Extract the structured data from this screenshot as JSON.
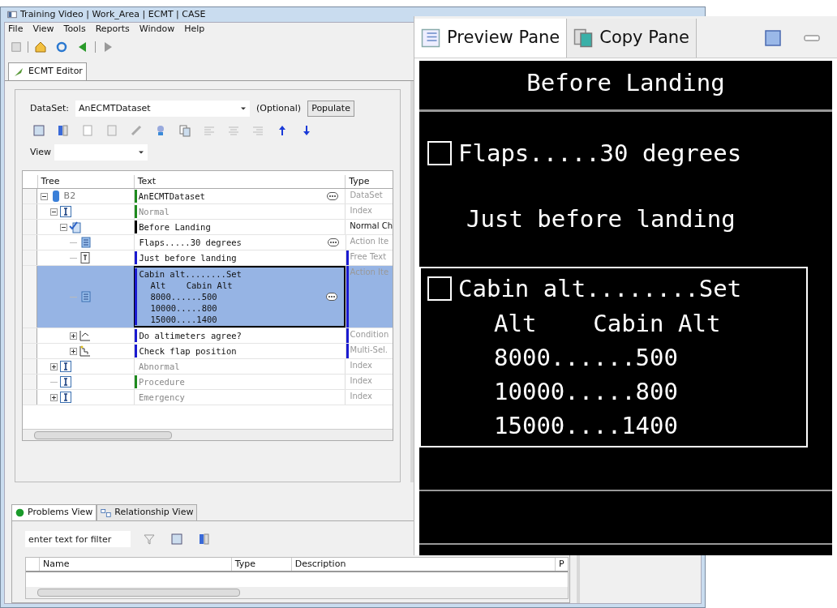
{
  "window": {
    "title": "Training Video | Work_Area | ECMT | CASE"
  },
  "menu": [
    "File",
    "View",
    "Tools",
    "Reports",
    "Window",
    "Help"
  ],
  "editor_tab": {
    "label": "ECMT Editor",
    "selected": true
  },
  "dataset": {
    "label": "DataSet:",
    "value": "AnECMTDataset",
    "optional": "(Optional)",
    "button": "Populate"
  },
  "view": {
    "label": "View"
  },
  "tree_table": {
    "columns": [
      "Tree",
      "Text",
      "Type"
    ],
    "rows": [
      {
        "kind": "dataset",
        "tree_label": "B2",
        "text": "AnECMTDataset",
        "type": "DataSet",
        "type_marked": false,
        "color": "#1e8a1e",
        "expanded": true,
        "selected": false,
        "dimmed": false,
        "more_button": true,
        "children": [
          {
            "kind": "index",
            "text": "Normal",
            "type": "Index",
            "type_marked": false,
            "color": "#1e8a1e",
            "expanded": true,
            "selected": false,
            "dimmed": true,
            "more_button": false,
            "children": [
              {
                "kind": "checklist",
                "text": "Before Landing",
                "type": "Normal Ch",
                "type_marked": false,
                "color": "#000000",
                "expanded": true,
                "selected": false,
                "dimmed": false,
                "more_button": false,
                "children": [
                  {
                    "kind": "action",
                    "text": "Flaps.....30 degrees",
                    "type": "Action Ite",
                    "type_marked": false,
                    "selected": false,
                    "dimmed": false,
                    "more_button": true
                  },
                  {
                    "kind": "freetext",
                    "text": "Just before landing",
                    "type": "Free Text",
                    "color": "#1a1ad0",
                    "type_marked": true,
                    "selected": false,
                    "dimmed": false,
                    "more_button": false
                  },
                  {
                    "kind": "action",
                    "text": "Cabin alt........Set",
                    "lines": [
                      "Alt    Cabin Alt",
                      "8000......500",
                      "10000.....800",
                      "15000....1400"
                    ],
                    "type": "Action Ite",
                    "color": "#1a1ad0",
                    "type_marked": true,
                    "selected": true,
                    "dimmed": false,
                    "more_button": true
                  },
                  {
                    "kind": "condition",
                    "text": "Do altimeters agree?",
                    "type": "Condition",
                    "color": "#1a1ad0",
                    "type_marked": true,
                    "expanded": false,
                    "selected": false,
                    "dimmed": false,
                    "more_button": false
                  },
                  {
                    "kind": "multiselect",
                    "text": "Check flap position",
                    "type": "Multi-Sel.",
                    "color": "#1a1ad0",
                    "type_marked": true,
                    "expanded": false,
                    "selected": false,
                    "dimmed": false,
                    "more_button": false
                  }
                ]
              }
            ]
          },
          {
            "kind": "index",
            "text": "Abnormal",
            "type": "Index",
            "type_marked": false,
            "expanded": false,
            "selected": false,
            "dimmed": true,
            "more_button": false
          },
          {
            "kind": "index",
            "text": "Procedure",
            "type": "Index",
            "type_marked": false,
            "color": "#1e8a1e",
            "selected": false,
            "dimmed": true,
            "more_button": false
          },
          {
            "kind": "index",
            "text": "Emergency",
            "type": "Index",
            "type_marked": false,
            "expanded": false,
            "selected": false,
            "dimmed": true,
            "more_button": false
          }
        ]
      }
    ]
  },
  "bottom_panel": {
    "tabs": [
      {
        "label": "Problems View",
        "selected": true
      },
      {
        "label": "Relationship View",
        "selected": false
      }
    ],
    "filter": {
      "placeholder": "enter text for filter"
    },
    "columns": [
      "Name",
      "Type",
      "Description",
      "P"
    ]
  },
  "preview": {
    "tabs": [
      {
        "label": "Preview Pane",
        "selected": true
      },
      {
        "label": "Copy Pane",
        "selected": false
      }
    ],
    "title": "Before Landing",
    "items": [
      {
        "kind": "check",
        "text": "Flaps.....30 degrees",
        "checked": false,
        "selected": false
      },
      {
        "kind": "note",
        "text": "Just before landing",
        "selected": false
      },
      {
        "kind": "check",
        "text": "Cabin alt........Set",
        "lines": [
          "Alt    Cabin Alt",
          "8000......500",
          "10000.....800",
          "15000....1400"
        ],
        "checked": false,
        "selected": true
      }
    ]
  }
}
